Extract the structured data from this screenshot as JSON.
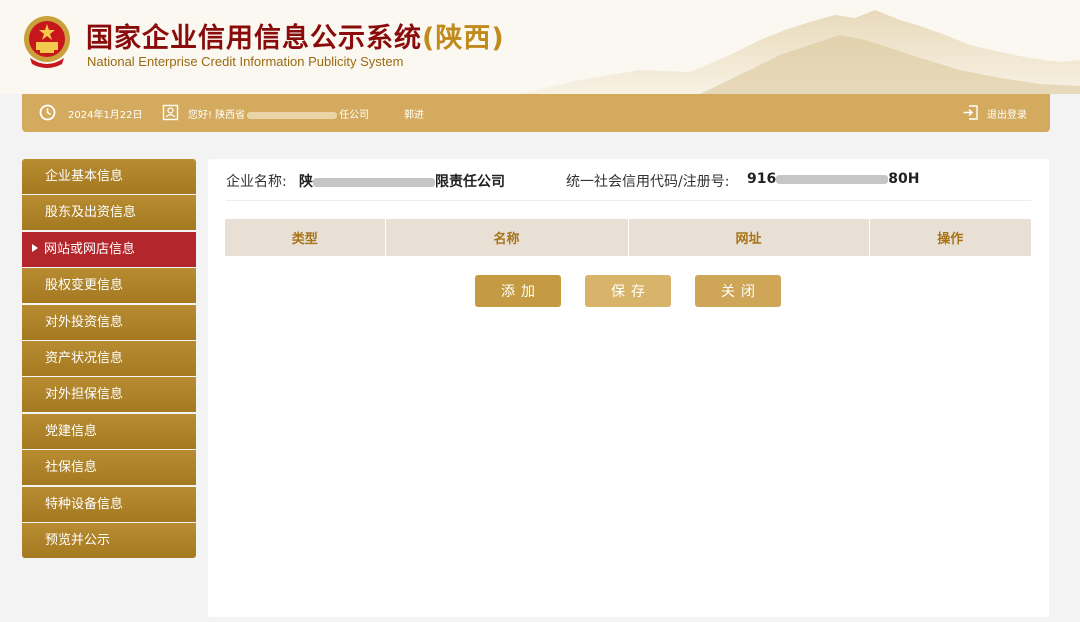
{
  "header": {
    "title_cn": "国家企业信用信息公示系统",
    "title_province": "(陕西)",
    "title_en": "National Enterprise Credit Information Publicity System"
  },
  "infobar": {
    "date": "2024年1月22日",
    "greeting_prefix": "您好! 陕西省",
    "greeting_suffix": "任公司",
    "user_name": "郭进",
    "logout_label": "退出登录"
  },
  "sidebar": {
    "items": [
      {
        "label": "企业基本信息"
      },
      {
        "label": "股东及出资信息"
      },
      {
        "label": "网站或网店信息",
        "active": true
      },
      {
        "label": "股权变更信息"
      },
      {
        "label": "对外投资信息"
      },
      {
        "label": "资产状况信息"
      },
      {
        "label": "对外担保信息"
      },
      {
        "label": "党建信息"
      },
      {
        "label": "社保信息"
      },
      {
        "label": "特种设备信息"
      },
      {
        "label": "预览并公示"
      }
    ]
  },
  "main": {
    "company_label": "企业名称:",
    "company_value_prefix": "陕",
    "company_value_suffix": "限责任公司",
    "code_label": "统一社会信用代码/注册号:",
    "code_value_prefix": "916",
    "code_value_suffix": "80H",
    "table": {
      "columns": [
        "类型",
        "名称",
        "网址",
        "操作"
      ],
      "rows": []
    },
    "buttons": {
      "add": "添加",
      "save": "保存",
      "close": "关闭"
    }
  },
  "colors": {
    "brand_gold": "#d4ab5e",
    "sidebar_gold": "#b08428",
    "active_red": "#b3262b",
    "title_red": "#8a0b0b"
  }
}
